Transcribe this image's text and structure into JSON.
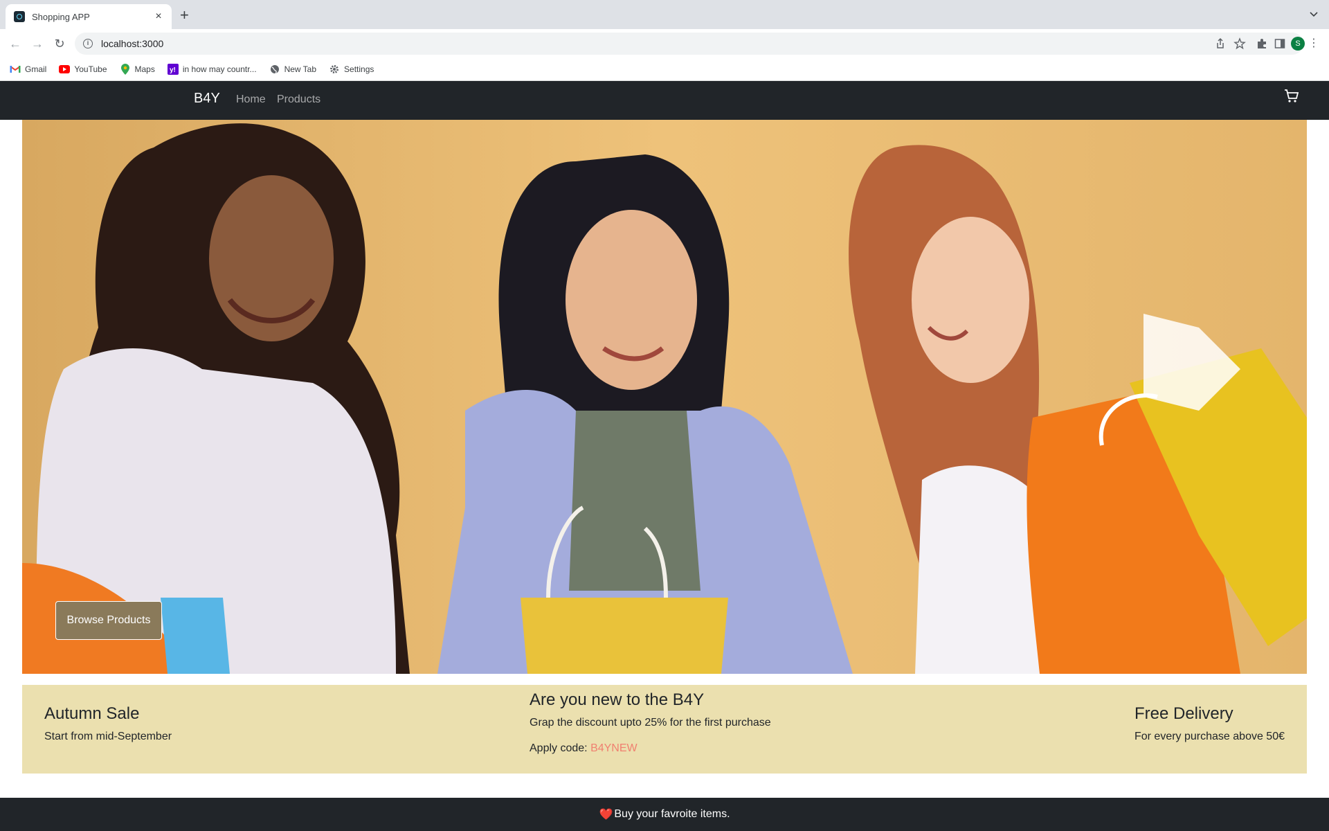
{
  "browser": {
    "tab_title": "Shopping APP",
    "url": "localhost:3000",
    "bookmarks": [
      {
        "label": "Gmail",
        "icon": "gmail-icon"
      },
      {
        "label": "YouTube",
        "icon": "youtube-icon"
      },
      {
        "label": "Maps",
        "icon": "maps-icon"
      },
      {
        "label": "in how may countr...",
        "icon": "yahoo-icon"
      },
      {
        "label": "New Tab",
        "icon": "globe-icon"
      },
      {
        "label": "Settings",
        "icon": "gear-icon"
      }
    ],
    "profile_initial": "S"
  },
  "navbar": {
    "brand": "B4Y",
    "links": [
      "Home",
      "Products"
    ]
  },
  "hero": {
    "button_label": "Browse Products"
  },
  "promo": {
    "left": {
      "title": "Autumn Sale",
      "text": "Start from mid-September"
    },
    "center": {
      "title": "Are you new to the B4Y",
      "text": "Grap the discount upto 25% for the first purchase",
      "code_prefix": "Apply code: ",
      "code": "B4YNEW"
    },
    "right": {
      "title": "Free Delivery",
      "text": "For every purchase above 50€"
    }
  },
  "footer": {
    "heart": "❤️",
    "text": "Buy your favroite items."
  },
  "colors": {
    "navbar_bg": "#212529",
    "promo_bg": "#ebe0af",
    "code_color": "#f08070",
    "hero_wall": "#e6b569"
  }
}
